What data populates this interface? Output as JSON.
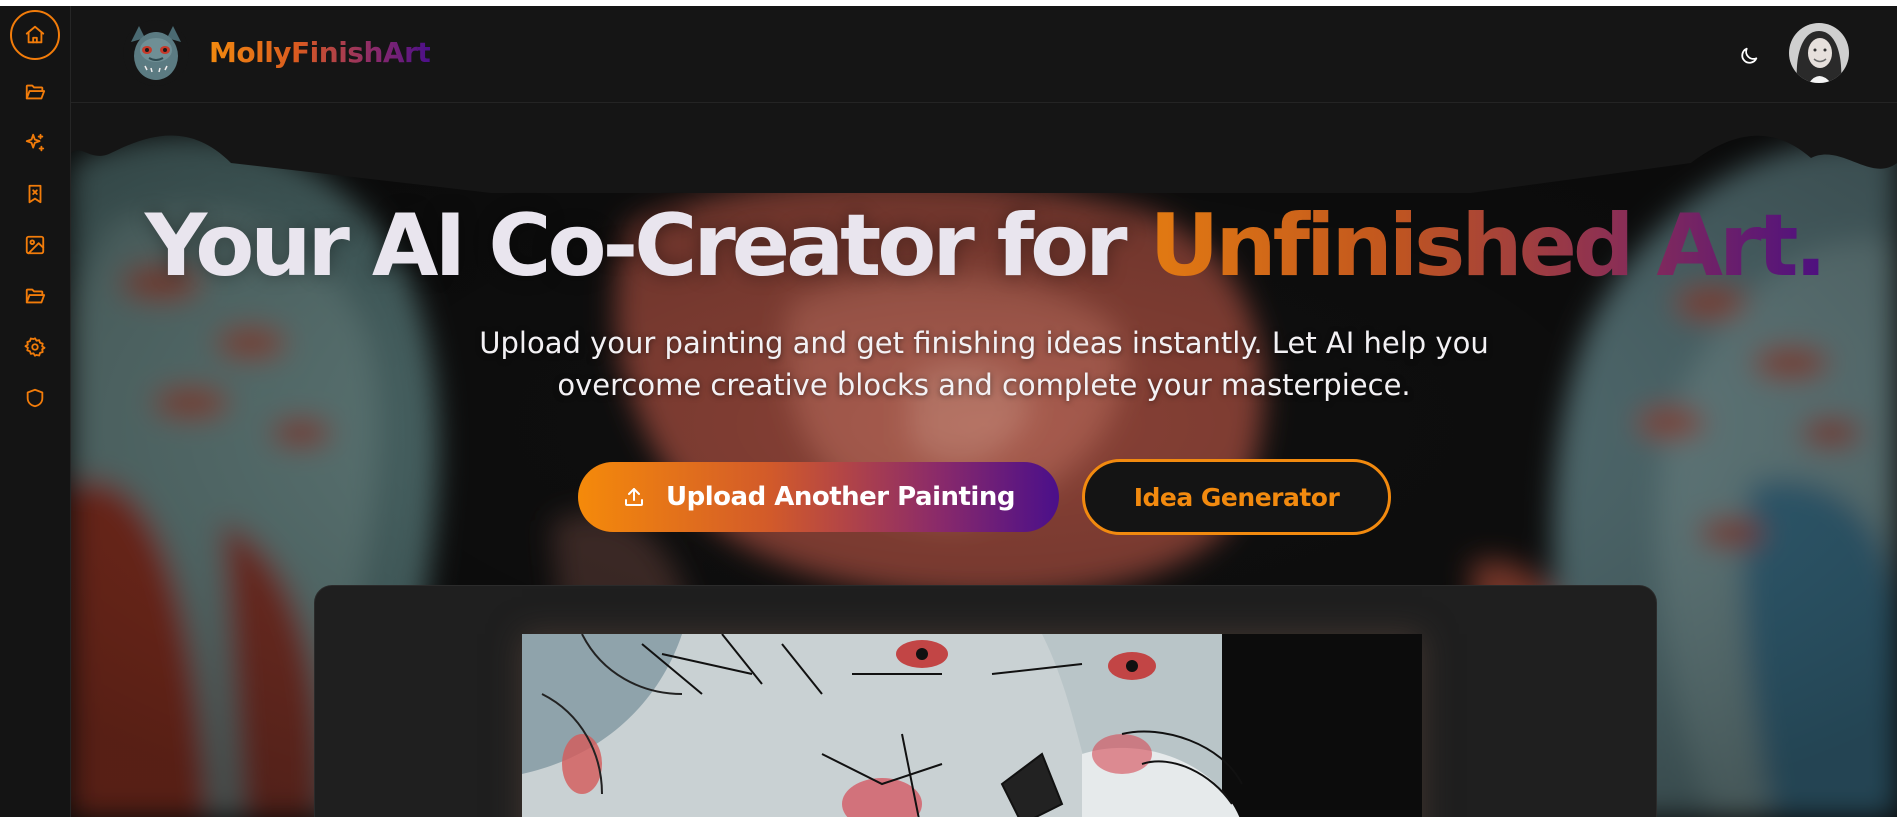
{
  "app": {
    "brand": "MollyFinishArt",
    "logo_icon": "dragon-mask-logo",
    "avatar_icon": "user-avatar"
  },
  "sidebar": {
    "items": [
      {
        "icon": "home-icon",
        "active": true
      },
      {
        "icon": "folder-open-icon",
        "active": false
      },
      {
        "icon": "sparkles-icon",
        "active": false
      },
      {
        "icon": "bookmark-x-icon",
        "active": false
      },
      {
        "icon": "image-icon",
        "active": false
      },
      {
        "icon": "folder-open-icon",
        "active": false
      },
      {
        "icon": "settings-icon",
        "active": false
      },
      {
        "icon": "shield-icon",
        "active": false
      }
    ]
  },
  "header": {
    "theme_toggle_icon": "moon-icon"
  },
  "hero": {
    "headline_plain": "Your AI Co-Creator for ",
    "headline_accent": "Unfinished Art.",
    "subtitle": "Upload your painting and get finishing ideas instantly. Let AI help you overcome creative blocks and complete your masterpiece.",
    "upload_button": "Upload Another Painting",
    "upload_icon": "upload-icon",
    "idea_button": "Idea Generator"
  },
  "colors": {
    "accent_orange": "#f28a0f",
    "accent_purple": "#4b0f8a",
    "background": "#141414"
  }
}
